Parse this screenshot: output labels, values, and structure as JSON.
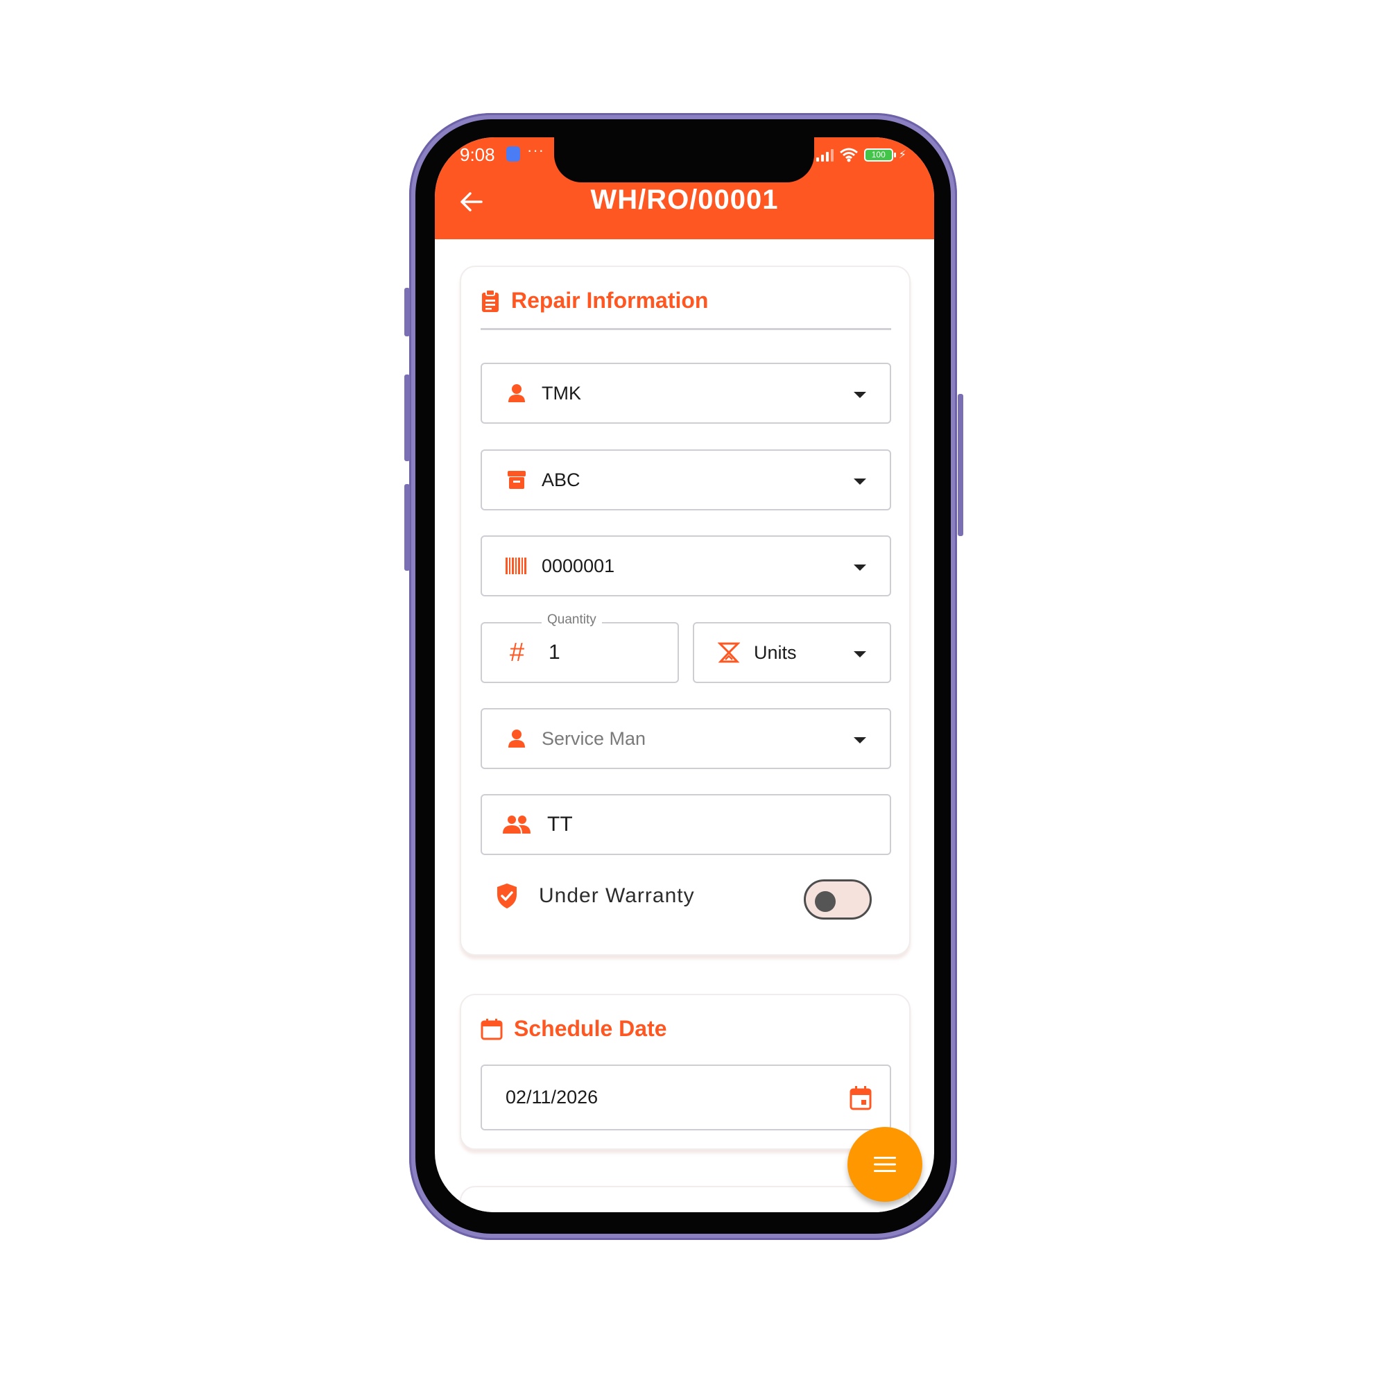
{
  "status_bar": {
    "time": "9:08",
    "dots": "···",
    "battery_level": "100"
  },
  "app_bar": {
    "title": "WH/RO/00001",
    "background_color": "#ff5722"
  },
  "repair_section": {
    "title": "Repair Information",
    "fields": {
      "customer": {
        "value": "TMK",
        "icon": "person-icon"
      },
      "vendor": {
        "value": "ABC",
        "icon": "archive-box-icon"
      },
      "product_barcode": {
        "value": "0000001",
        "icon": "barcode-icon"
      },
      "quantity": {
        "label": "Quantity",
        "value": "1",
        "icon": "hash-icon"
      },
      "unit": {
        "value": "Units",
        "icon": "scale-icon"
      },
      "service_man": {
        "placeholder": "Service Man",
        "icon": "person-icon"
      },
      "team": {
        "value": "TT",
        "icon": "group-icon"
      }
    },
    "warranty": {
      "label": "Under Warranty",
      "enabled": false
    }
  },
  "schedule_section": {
    "title": "Schedule Date",
    "date_value": "02/11/2026"
  },
  "accent_color": "#ff5722",
  "fab_color": "#ff9800"
}
